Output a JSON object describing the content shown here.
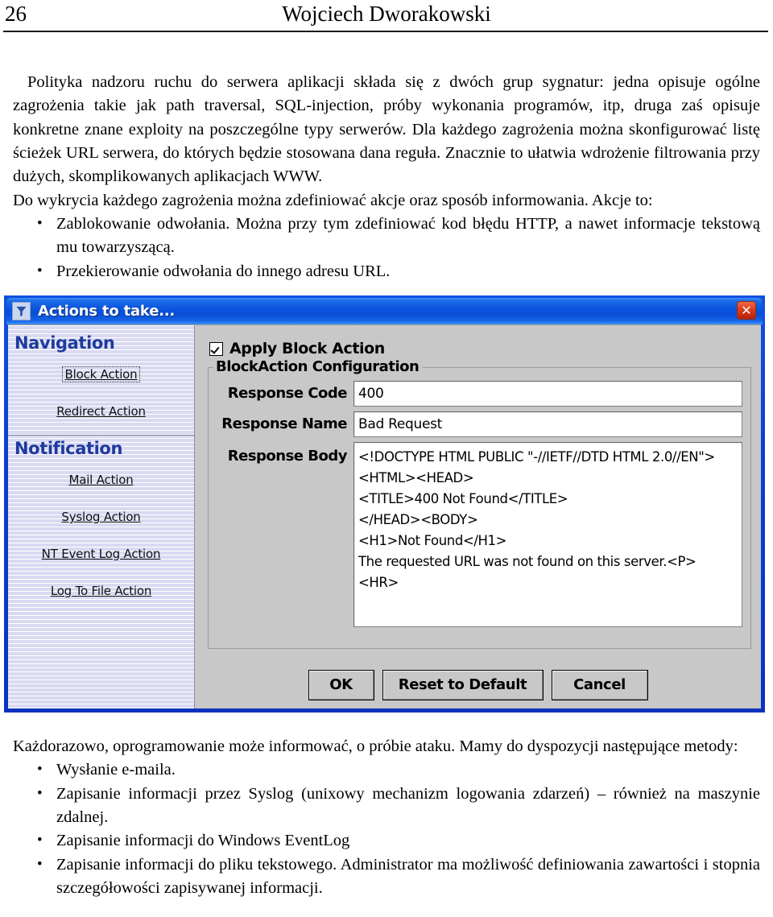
{
  "page": {
    "number": "26",
    "running_title": "Wojciech Dworakowski"
  },
  "prose_top": {
    "paragraph_1": "Polityka nadzoru ruchu do serwera aplikacji składa się z dwóch grup sygnatur: jedna opisuje ogólne zagrożenia takie jak path traversal, SQL-injection, próby wykonania programów, itp, druga zaś opisuje konkretne znane exploity na poszczególne typy serwerów. Dla każdego zagrożenia można skonfigurować listę ścieżek URL serwera, do których będzie stosowana dana reguła. Znacznie to ułatwia wdrożenie filtrowania przy dużych, skomplikowanych aplikacjach WWW.",
    "paragraph_2": "Do wykrycia każdego zagrożenia można zdefiniować akcje oraz sposób informowania. Akcje to:",
    "bullets": [
      "Zablokowanie odwołania. Można przy tym zdefiniować kod błędu HTTP, a nawet informacje tekstową mu towarzyszącą.",
      "Przekierowanie odwołania do innego adresu URL."
    ],
    "bullet_glyph": "•"
  },
  "prose_bottom": {
    "paragraph_1": "Każdorazowo, oprogramowanie może informować, o próbie ataku. Mamy do dyspozycji następujące metody:",
    "bullets": [
      "Wysłanie e-maila.",
      "Zapisanie informacji przez Syslog (unixowy mechanizm logowania zdarzeń) – również na maszynie zdalnej.",
      "Zapisanie informacji do Windows EventLog",
      "Zapisanie informacji do pliku tekstowego. Administrator ma możliwość definiowania zawartości i stopnia szczegółowości zapisywanej informacji."
    ],
    "bullet_glyph": "•"
  },
  "dialog": {
    "title": "Actions to take...",
    "title_icon": "funnel-icon",
    "close_label": "✕",
    "colors": {
      "titlebar_blue": "#0b53dd",
      "frame_blue": "#0a36c8",
      "panel_lavender": "#d9d9f2",
      "section_heading_blue": "#1e3a9e",
      "dialog_gray": "#c8c8c8",
      "close_red": "#dd3a1c"
    },
    "navigation": {
      "sections": [
        {
          "title": "Navigation",
          "items": [
            {
              "label": "Block Action",
              "focused": true
            },
            {
              "label": "Redirect Action",
              "focused": false
            }
          ]
        },
        {
          "title": "Notification",
          "items": [
            {
              "label": "Mail Action",
              "focused": false
            },
            {
              "label": "Syslog Action",
              "focused": false
            },
            {
              "label": "NT Event Log Action",
              "focused": false
            },
            {
              "label": "Log To File Action",
              "focused": false
            }
          ]
        }
      ]
    },
    "config": {
      "apply_checkbox_label": "Apply Block Action",
      "apply_checkbox_checked": true,
      "groupbox_title": "BlockAction Configuration",
      "fields": [
        {
          "label": "Response Code",
          "value": "400"
        },
        {
          "label": "Response Name",
          "value": "Bad Request"
        }
      ],
      "body_field": {
        "label": "Response Body",
        "value": "<!DOCTYPE HTML PUBLIC \"-//IETF//DTD HTML 2.0//EN\">\n<HTML><HEAD>\n<TITLE>400 Not Found</TITLE>\n</HEAD><BODY>\n<H1>Not Found</H1>\nThe requested URL was not found on this server.<P>\n<HR>"
      },
      "buttons": [
        {
          "label": "OK"
        },
        {
          "label": "Reset to Default"
        },
        {
          "label": "Cancel"
        }
      ]
    }
  }
}
